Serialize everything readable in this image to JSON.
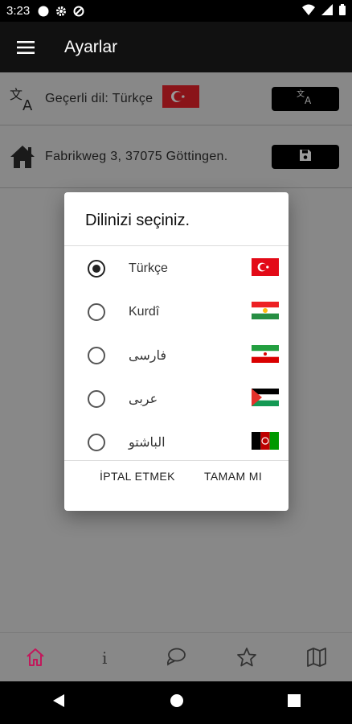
{
  "status_bar": {
    "time": "3:23"
  },
  "app_bar": {
    "title": "Ayarlar"
  },
  "settings": {
    "language_row": {
      "text": "Geçerli dil: Türkçe"
    },
    "address_row": {
      "text": "Fabrikweg 3, 37075 Göttingen."
    }
  },
  "dialog": {
    "title": "Dilinizi seçiniz.",
    "options": [
      {
        "label": "Türkçe",
        "selected": true,
        "flag": "turkey-flag-icon"
      },
      {
        "label": "Kurdî",
        "selected": false,
        "flag": "kurdistan-flag-icon"
      },
      {
        "label": "فارسی",
        "selected": false,
        "flag": "iran-flag-icon"
      },
      {
        "label": "عربى",
        "selected": false,
        "flag": "palestine-flag-icon"
      },
      {
        "label": "الباشتو",
        "selected": false,
        "flag": "afghanistan-flag-icon"
      }
    ],
    "cancel_label": "İPTAL ETMEK",
    "ok_label": "TAMAM MI"
  },
  "bottom_nav": {
    "items": [
      "home-icon",
      "info-icon",
      "chat-icon",
      "star-icon",
      "map-icon"
    ],
    "active_color": "#c2185b"
  },
  "colors": {
    "scrim": "#888888",
    "app_bar": "#111111"
  }
}
